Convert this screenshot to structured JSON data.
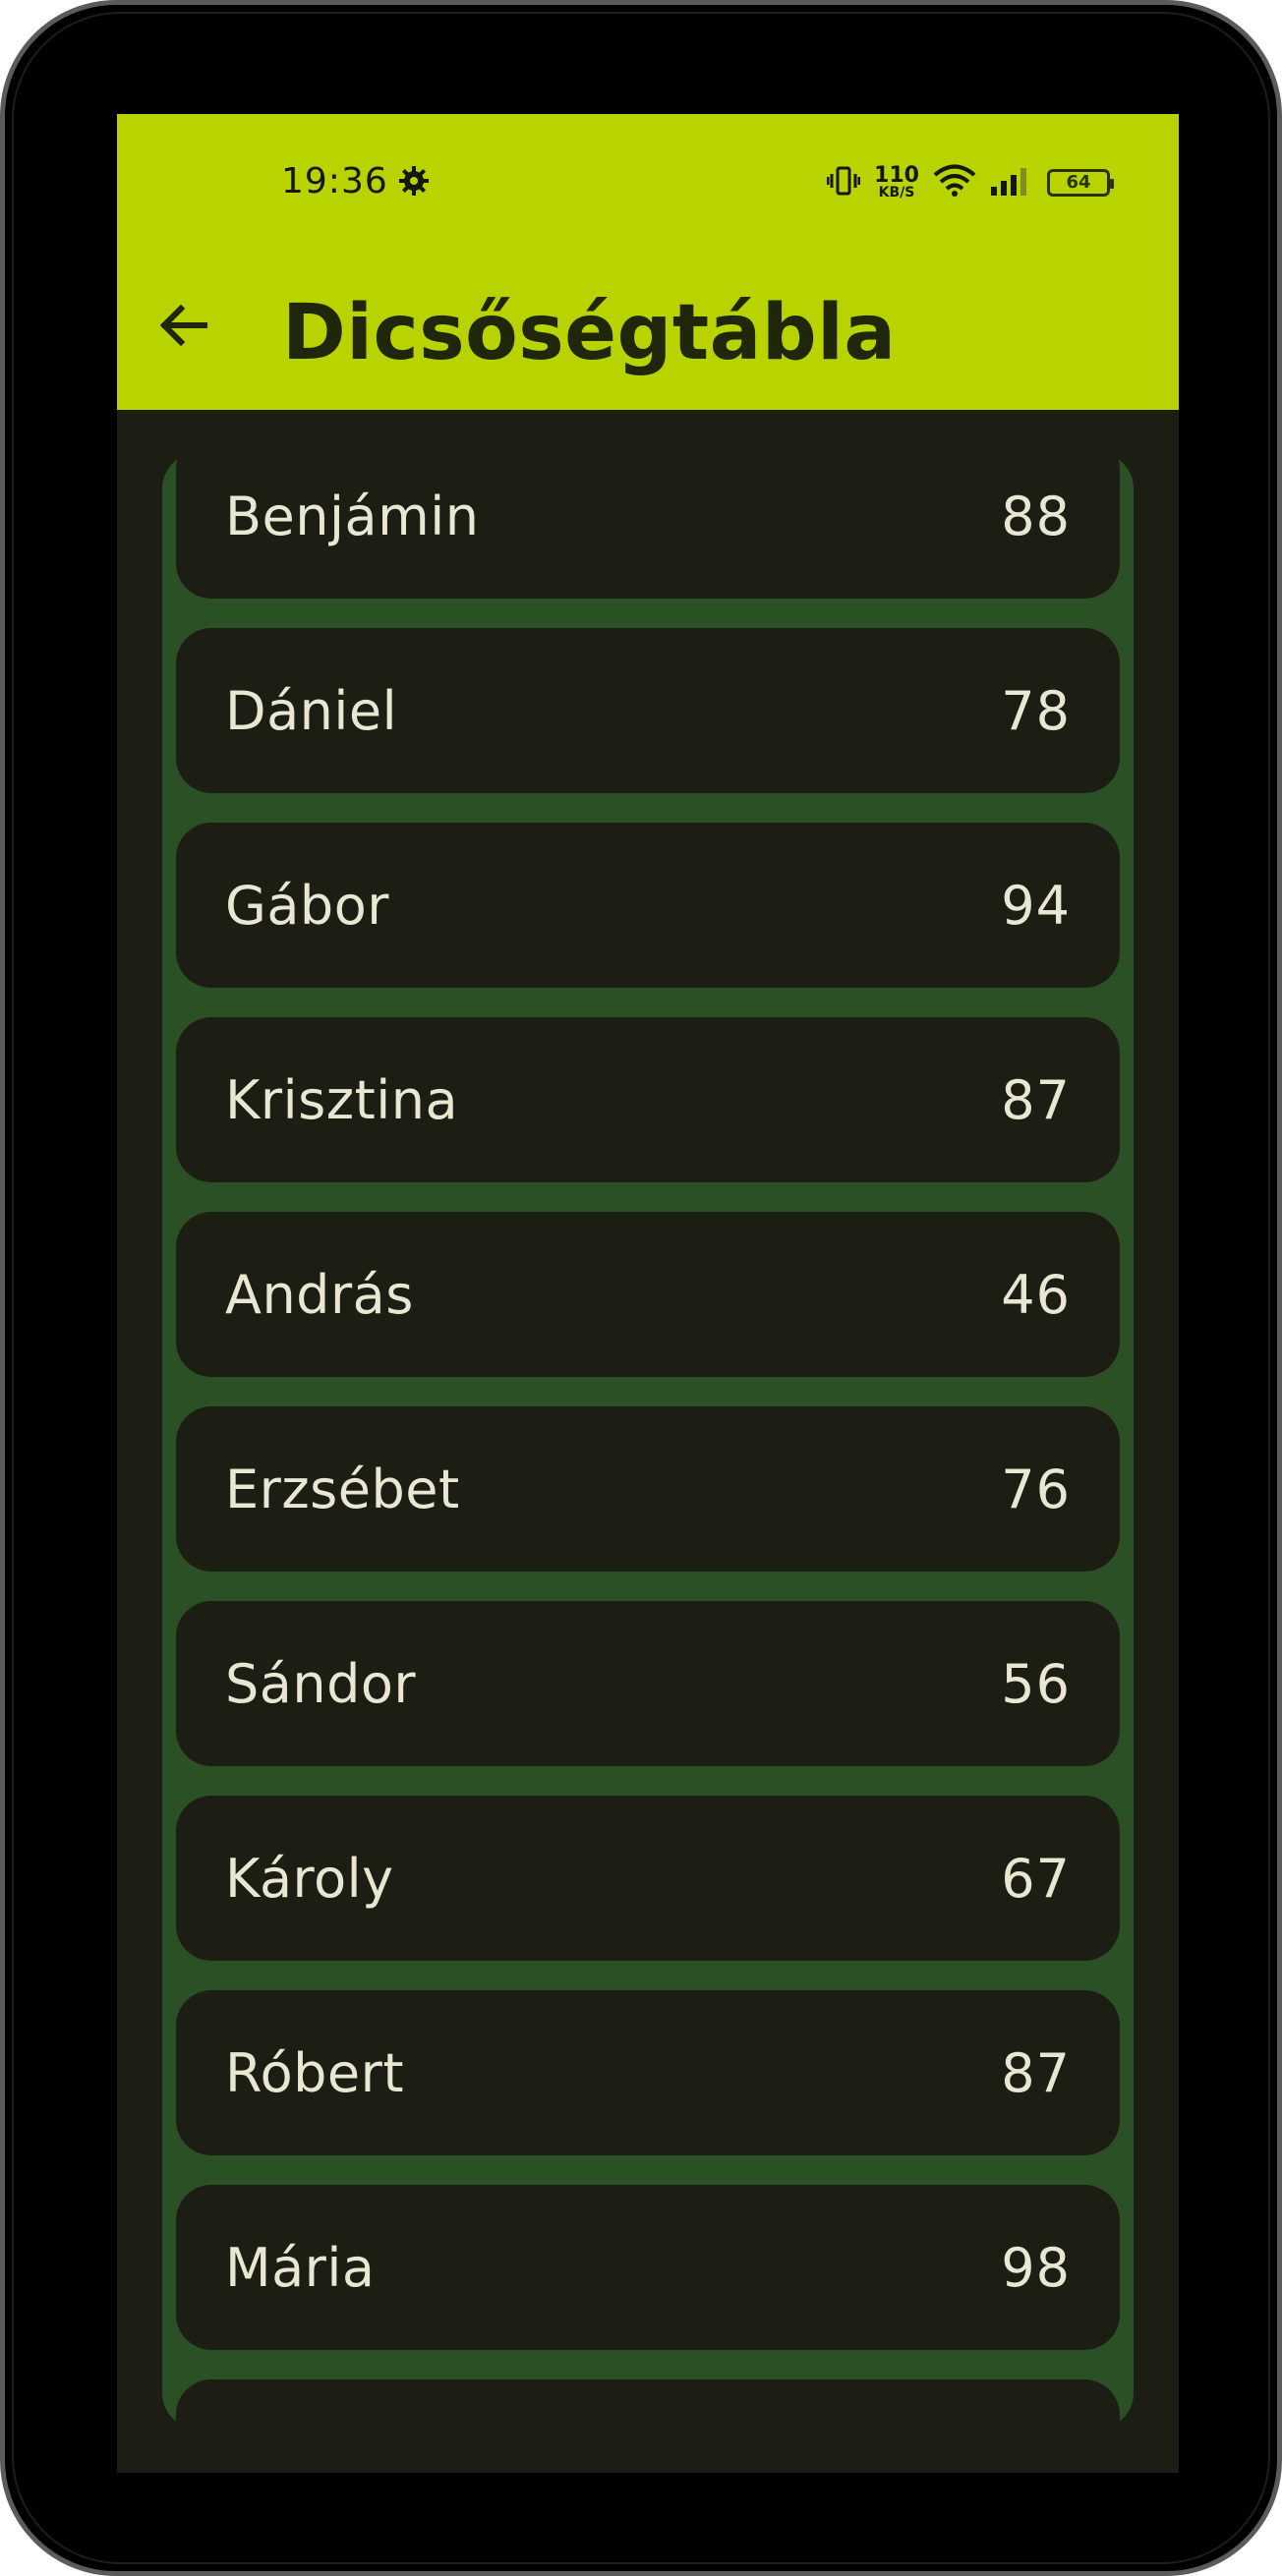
{
  "status_bar": {
    "time": "19:36",
    "network_speed_value": "110",
    "network_speed_unit": "KB/S",
    "battery": "64",
    "icons": [
      "settings-gear-icon",
      "vibrate-icon",
      "wifi-icon",
      "signal-icon",
      "battery-icon"
    ]
  },
  "app_bar": {
    "title": "Dicsőségtábla",
    "back_icon": "arrow-left-icon"
  },
  "colors": {
    "app_bar": "#b8d300",
    "background": "#1c1d13",
    "list_container": "#2c5026",
    "card": "#1c1d13",
    "text": "#e8e8d2"
  },
  "leaderboard": [
    {
      "name": "Benjámin",
      "score": "88"
    },
    {
      "name": "Dániel",
      "score": "78"
    },
    {
      "name": "Gábor",
      "score": "94"
    },
    {
      "name": "Krisztina",
      "score": "87"
    },
    {
      "name": "András",
      "score": "46"
    },
    {
      "name": "Erzsébet",
      "score": "76"
    },
    {
      "name": "Sándor",
      "score": "56"
    },
    {
      "name": "Károly",
      "score": "67"
    },
    {
      "name": "Róbert",
      "score": "87"
    },
    {
      "name": "Mária",
      "score": "98"
    },
    {
      "name": "",
      "score": ""
    }
  ]
}
